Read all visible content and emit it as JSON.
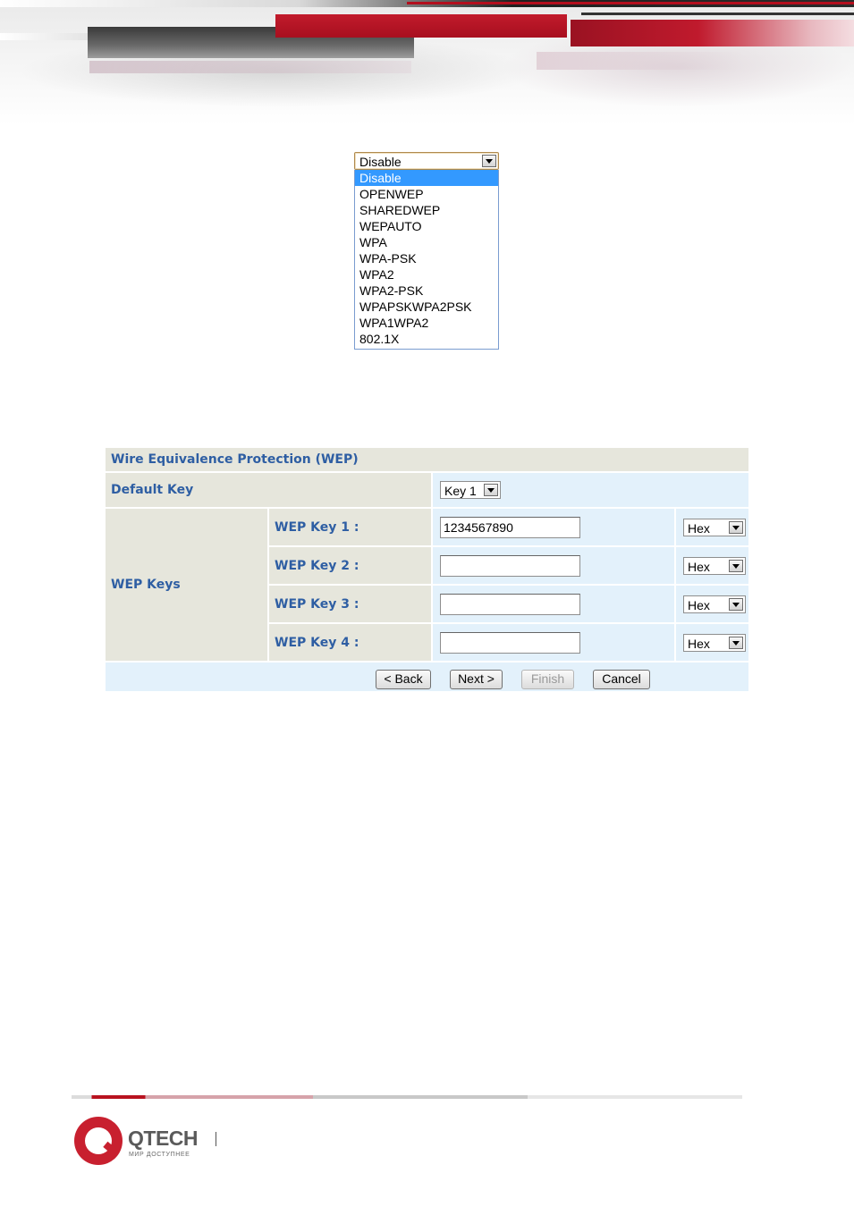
{
  "security_dropdown": {
    "selected": "Disable",
    "options": [
      "Disable",
      "OPENWEP",
      "SHAREDWEP",
      "WEPAUTO",
      "WPA",
      "WPA-PSK",
      "WPA2",
      "WPA2-PSK",
      "WPAPSKWPA2PSK",
      "WPA1WPA2",
      "802.1X"
    ],
    "highlighted_index": 0
  },
  "wep": {
    "title": "Wire Equivalence Protection (WEP)",
    "default_key_label": "Default Key",
    "default_key_value": "Key 1",
    "keys_group_label": "WEP Keys",
    "keys": [
      {
        "label": "WEP Key 1 :",
        "value": "1234567890",
        "format": "Hex"
      },
      {
        "label": "WEP Key 2 :",
        "value": "",
        "format": "Hex"
      },
      {
        "label": "WEP Key 3 :",
        "value": "",
        "format": "Hex"
      },
      {
        "label": "WEP Key 4 :",
        "value": "",
        "format": "Hex"
      }
    ],
    "buttons": {
      "back": "< Back",
      "next": "Next >",
      "finish": "Finish",
      "cancel": "Cancel"
    }
  },
  "footer": {
    "brand": "QTECH",
    "tagline": "МИР ДОСТУПНЕЕ"
  },
  "colors": {
    "label_blue": "#2e5ea3",
    "header_grey": "#e6e6dc",
    "value_blue": "#e3f1fb",
    "selection_blue": "#3399ff",
    "brand_red": "#c8202f"
  }
}
